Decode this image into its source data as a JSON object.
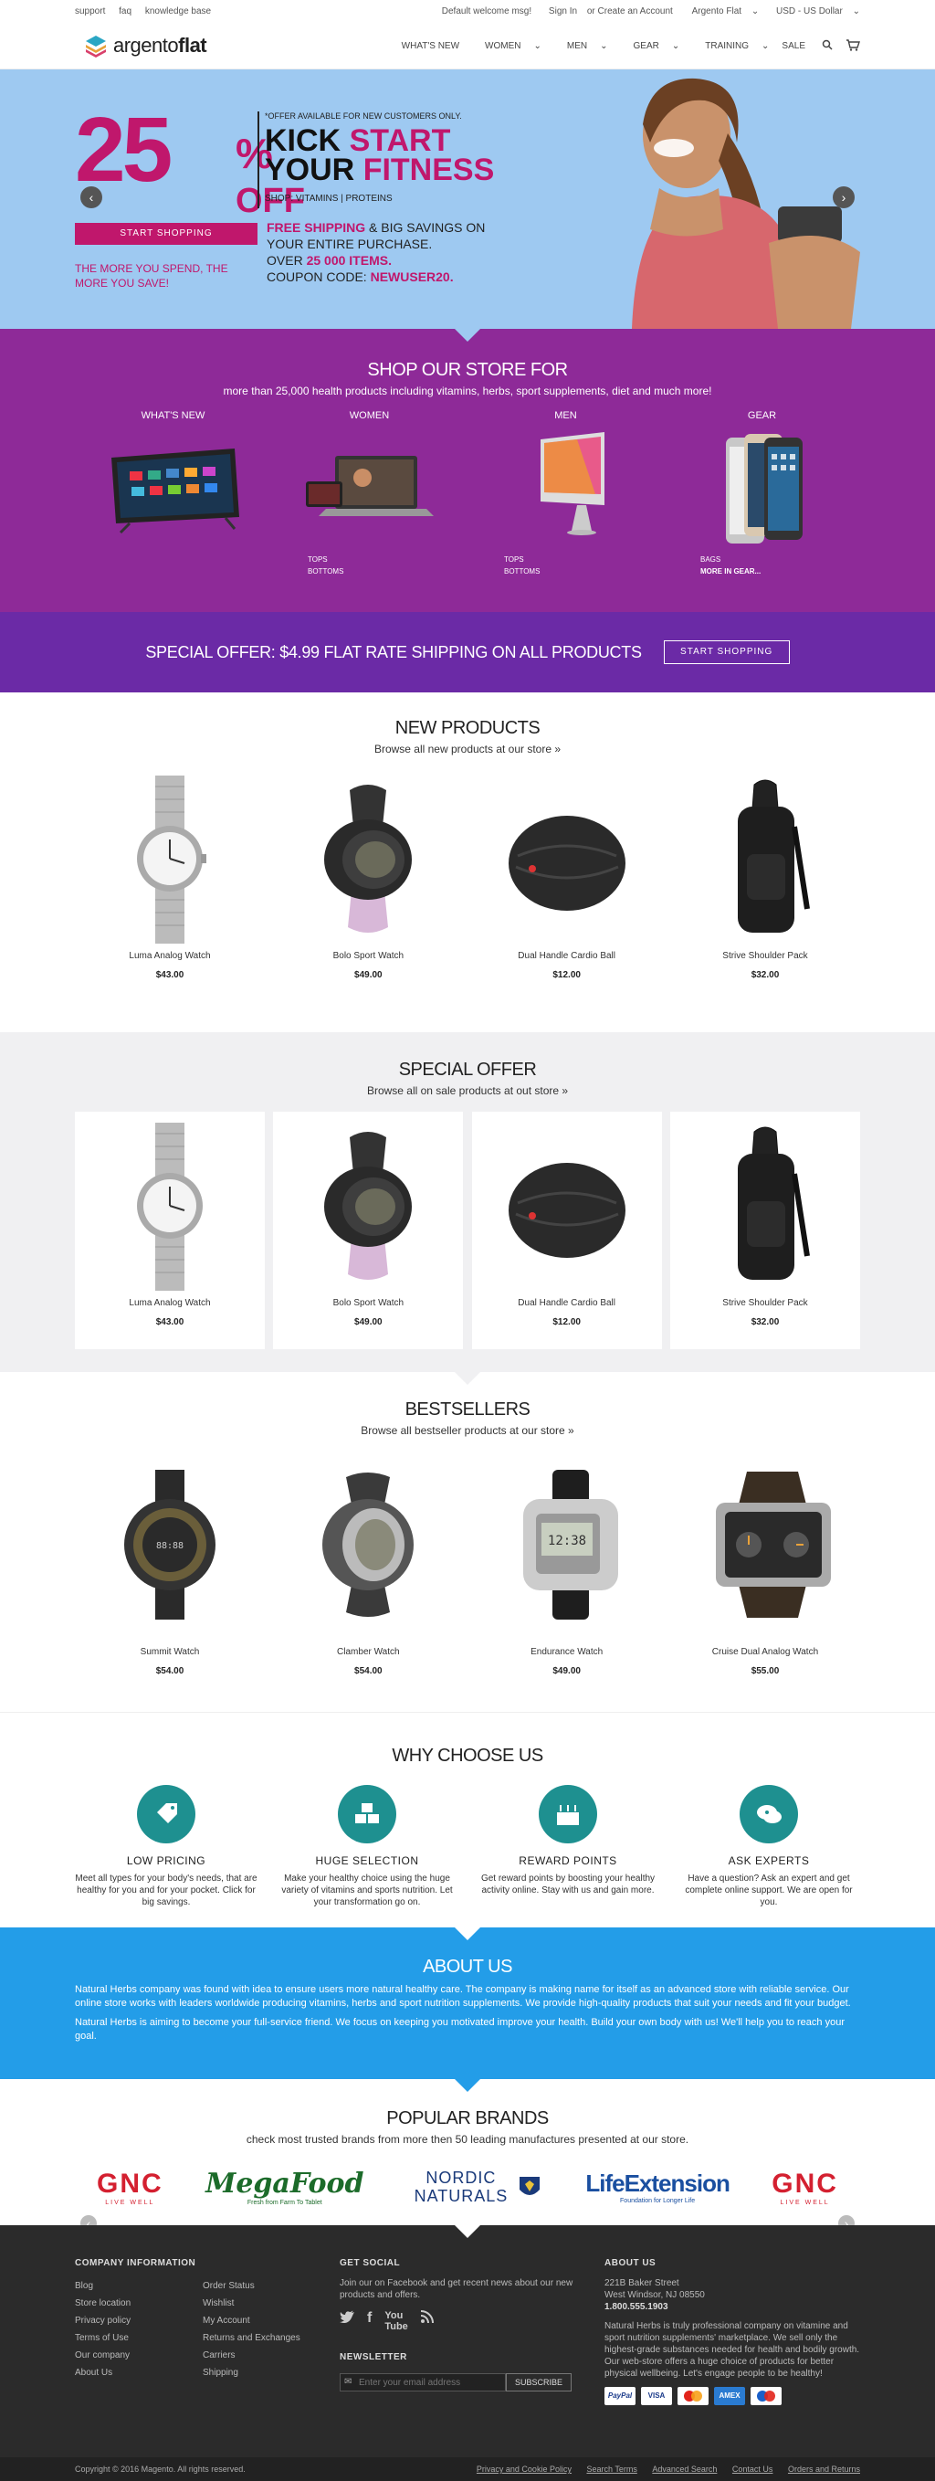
{
  "topbar": {
    "left": [
      "support",
      "faq",
      "knowledge base"
    ],
    "welcome": "Default welcome msg!",
    "sign_in": "Sign In",
    "or": "or",
    "create_account": "Create an Account",
    "store": "Argento Flat",
    "currency": "USD - US Dollar"
  },
  "header": {
    "logo_light": "argento",
    "logo_bold": "flat",
    "nav": [
      "WHAT'S NEW",
      "WOMEN",
      "MEN",
      "GEAR",
      "TRAINING",
      "SALE"
    ]
  },
  "hero": {
    "percent": "25",
    "percent_sign": "%",
    "off": "OFF",
    "note": "*OFFER AVAILABLE FOR NEW CUSTOMERS ONLY.",
    "kick": "KICK",
    "start": "START",
    "your": "YOUR",
    "fitness": "FITNESS",
    "shop_line": "SHOP: VITAMINS  |  PROTEINS",
    "button": "START SHOPPING",
    "more": "THE MORE YOU SPEND, THE MORE YOU SAVE!",
    "free_shipping": "FREE SHIPPING",
    "free_rest": " & BIG SAVINGS ON",
    "line2": "YOUR ENTIRE PURCHASE.",
    "over": "OVER ",
    "items": "25 000 ITEMS.",
    "coupon": "COUPON CODE: ",
    "code": "NEWUSER20."
  },
  "store": {
    "title": "SHOP OUR STORE FOR",
    "subtitle": "more than 25,000 health products including vitamins, herbs, sport supplements, diet and much more!",
    "categories": [
      {
        "title": "WHAT'S NEW",
        "links": []
      },
      {
        "title": "WOMEN",
        "links": [
          "TOPS",
          "BOTTOMS"
        ]
      },
      {
        "title": "MEN",
        "links": [
          "TOPS",
          "BOTTOMS"
        ]
      },
      {
        "title": "GEAR",
        "links": [
          "BAGS",
          "MORE IN GEAR..."
        ]
      }
    ]
  },
  "special_bar": {
    "text": "SPECIAL OFFER: $4.99 FLAT RATE SHIPPING ON ALL PRODUCTS",
    "button": "START SHOPPING"
  },
  "new_products": {
    "title": "NEW PRODUCTS",
    "subtitle": "Browse all new products at our store »",
    "items": [
      {
        "name": "Luma Analog Watch",
        "price": "$43.00"
      },
      {
        "name": "Bolo Sport Watch",
        "price": "$49.00"
      },
      {
        "name": "Dual Handle Cardio Ball",
        "price": "$12.00"
      },
      {
        "name": "Strive Shoulder Pack",
        "price": "$32.00"
      }
    ]
  },
  "special_offer": {
    "title": "SPECIAL OFFER",
    "subtitle": "Browse all on sale products at out store »",
    "items": [
      {
        "name": "Luma Analog Watch",
        "price": "$43.00"
      },
      {
        "name": "Bolo Sport Watch",
        "price": "$49.00"
      },
      {
        "name": "Dual Handle Cardio Ball",
        "price": "$12.00"
      },
      {
        "name": "Strive Shoulder Pack",
        "price": "$32.00"
      }
    ]
  },
  "bestsellers": {
    "title": "BESTSELLERS",
    "subtitle": "Browse all bestseller products at our store »",
    "items": [
      {
        "name": "Summit Watch",
        "price": "$54.00"
      },
      {
        "name": "Clamber Watch",
        "price": "$54.00"
      },
      {
        "name": "Endurance Watch",
        "price": "$49.00"
      },
      {
        "name": "Cruise Dual Analog Watch",
        "price": "$55.00"
      }
    ]
  },
  "why": {
    "title": "WHY CHOOSE US",
    "items": [
      {
        "title": "LOW PRICING",
        "text": "Meet all types for your body's needs, that are healthy for you and for your pocket. Click for big savings."
      },
      {
        "title": "HUGE SELECTION",
        "text": "Make your healthy choice using the huge variety of vitamins and sports nutrition. Let your transformation go on."
      },
      {
        "title": "REWARD POINTS",
        "text": "Get reward points by boosting your healthy activity online. Stay with us and gain more."
      },
      {
        "title": "ASK EXPERTS",
        "text": "Have a question? Ask an expert and get complete online support. We are open for you."
      }
    ]
  },
  "about": {
    "title": "ABOUT US",
    "p1": "Natural Herbs company was found with idea to ensure users more natural healthy care. The company is making name for itself as an advanced store with reliable service. Our online store works with leaders worldwide producing vitamins, herbs and sport nutrition supplements. We provide high-quality products that suit your needs and fit your budget.",
    "p2": "Natural Herbs is aiming to become your full-service friend. We focus on keeping you motivated improve your health. Build your own body with us! We'll help you to reach your goal."
  },
  "brands": {
    "title": "POPULAR BRANDS",
    "subtitle": "check most trusted brands from more then 50 leading manufactures presented at our store.",
    "items": [
      "GNC",
      "MegaFood",
      "NORDIC NATURALS",
      "LifeExtension",
      "GNC"
    ],
    "taglines": [
      "LIVE WELL",
      "Fresh from Farm To Tablet",
      "",
      "Foundation for Longer Life",
      "LIVE WELL"
    ]
  },
  "footer": {
    "company_title": "COMPANY INFORMATION",
    "col1": [
      "Blog",
      "Store location",
      "Privacy policy",
      "Terms of Use",
      "Our company",
      "About Us"
    ],
    "col2": [
      "Order Status",
      "Wishlist",
      "My Account",
      "Returns and Exchanges",
      "Carriers",
      "Shipping"
    ],
    "social_title": "GET SOCIAL",
    "social_text": "Join our on Facebook and get recent news about our new products and offers.",
    "newsletter_title": "NEWSLETTER",
    "newsletter_placeholder": "Enter your email address",
    "subscribe": "SUBSCRIBE",
    "about_title": "ABOUT US",
    "address1": "221B Baker Street",
    "address2": "West Windsor, NJ 08550",
    "phone": "1.800.555.1903",
    "about_text": "Natural Herbs is truly professional company on vitamine and sport nutrition supplements' marketplace. We sell only the highest-grade substances needed for health and bodily growth. Our web-store offers a huge choice of products for better physical wellbeing. Let's engage people to be healthy!",
    "cards": [
      "PayPal",
      "VISA",
      "MC",
      "AMEX",
      "Maestro"
    ],
    "copyright": "Copyright © 2016 Magento. All rights reserved.",
    "bottom_links": [
      "Privacy and Cookie Policy",
      "Search Terms",
      "Advanced Search",
      "Contact Us",
      "Orders and Returns"
    ]
  },
  "colors": {
    "pink": "#c0176c",
    "purple": "#8e2a98",
    "violet": "#6b2aa6",
    "teal": "#1e9090",
    "blue": "#239de8",
    "hero_bg": "#9ec9f1"
  }
}
